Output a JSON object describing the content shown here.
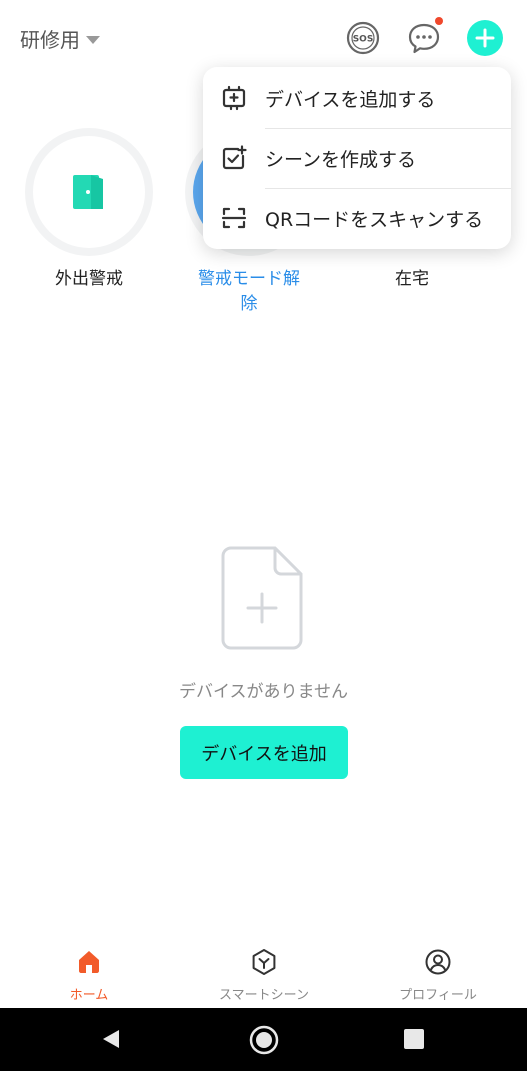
{
  "header": {
    "home_name": "研修用",
    "icons": {
      "sos": "sos-icon",
      "messages": "chat-bubble-icon",
      "add": "plus-icon"
    },
    "colors": {
      "accent": "#1ef0d2",
      "badge": "#f0482c"
    }
  },
  "scenes": [
    {
      "label": "外出警戒",
      "icon": "door-icon",
      "highlight": false
    },
    {
      "label": "警戒モード解除",
      "icon": "shield-icon",
      "highlight": true
    },
    {
      "label": "在宅",
      "icon": "home-icon",
      "highlight": false
    }
  ],
  "dropdown": {
    "items": [
      {
        "label": "デバイスを追加する",
        "icon": "device-add-icon"
      },
      {
        "label": "シーンを作成する",
        "icon": "scene-add-icon"
      },
      {
        "label": "QRコードをスキャンする",
        "icon": "qr-scan-icon"
      }
    ]
  },
  "empty_state": {
    "message": "デバイスがありません",
    "button_label": "デバイスを追加",
    "icon": "file-add-icon"
  },
  "tabbar": {
    "items": [
      {
        "label": "ホーム",
        "icon": "home-icon",
        "active": true
      },
      {
        "label": "スマートシーン",
        "icon": "hexagon-icon",
        "active": false
      },
      {
        "label": "プロフィール",
        "icon": "user-circle-icon",
        "active": false
      }
    ],
    "colors": {
      "active": "#f25b2a",
      "inactive": "#888888"
    }
  }
}
